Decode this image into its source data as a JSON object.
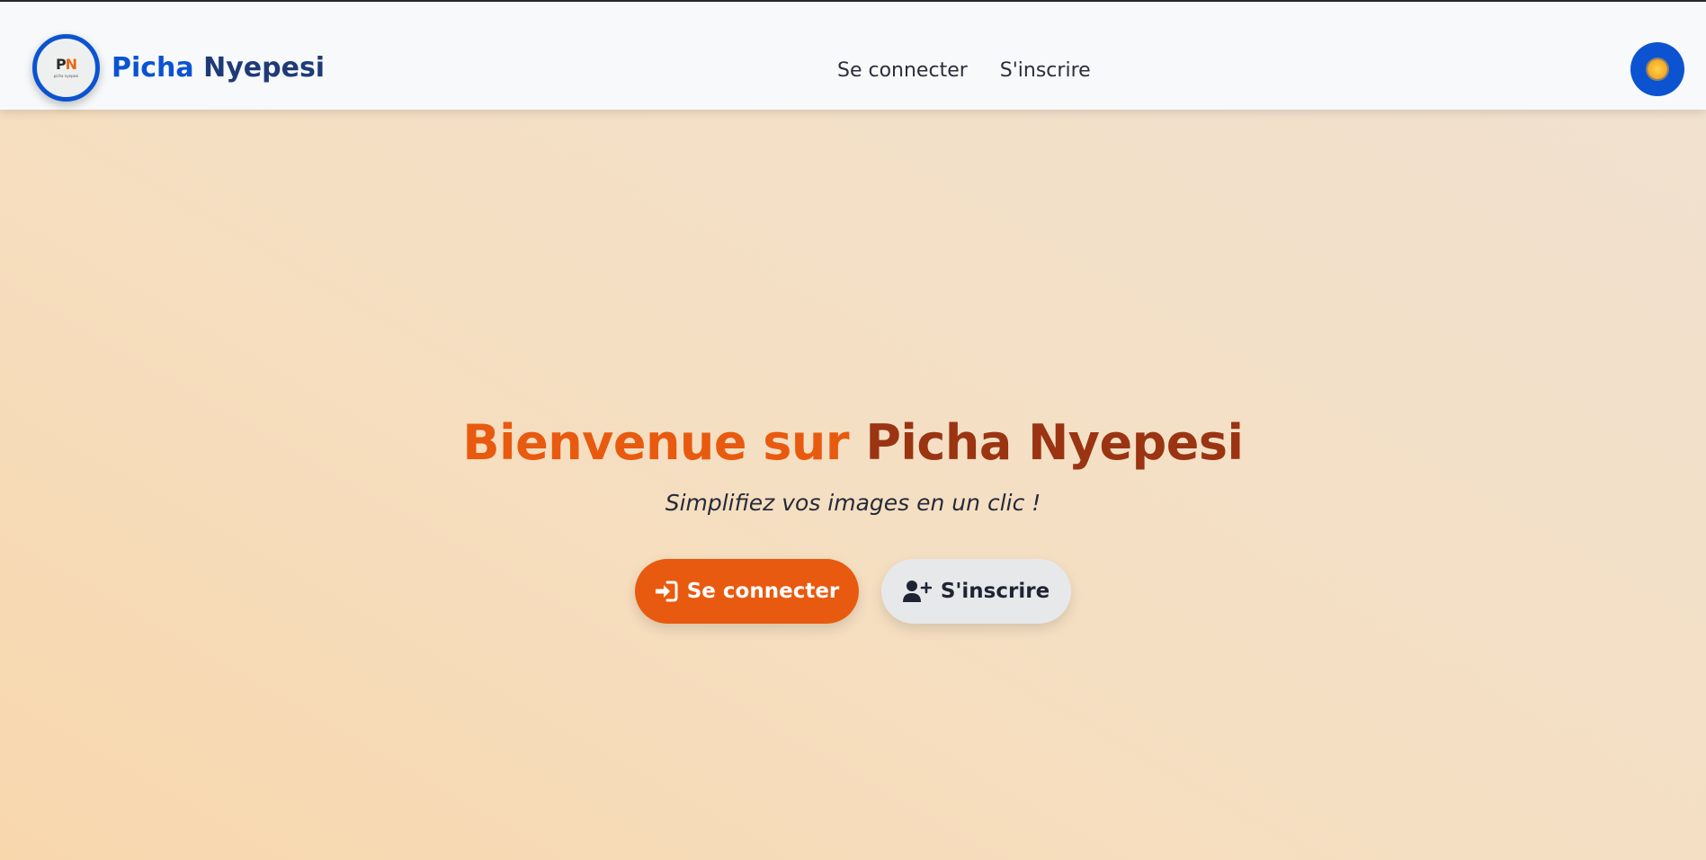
{
  "brand": {
    "logo_mark_p": "P",
    "logo_mark_n": "N",
    "logo_subtext": "picha nyepesi",
    "name_part1": "Picha",
    "name_part2": "Nyepesi"
  },
  "nav": {
    "login_label": "Se connecter",
    "signup_label": "S'inscrire"
  },
  "theme_toggle": {
    "icon": "sun-icon"
  },
  "hero": {
    "title_part1": "Bienvenue sur",
    "title_part2": "Picha Nyepesi",
    "tagline": "Simplifiez vos images en un clic !"
  },
  "actions": {
    "login_label": "Se connecter",
    "login_icon": "sign-in-icon",
    "signup_label": "S'inscrire",
    "signup_icon": "user-plus-icon"
  },
  "colors": {
    "accent_orange": "#e85a0f",
    "accent_brown": "#9a3412",
    "brand_blue": "#0b53d1",
    "brand_navy": "#1e3b78"
  }
}
